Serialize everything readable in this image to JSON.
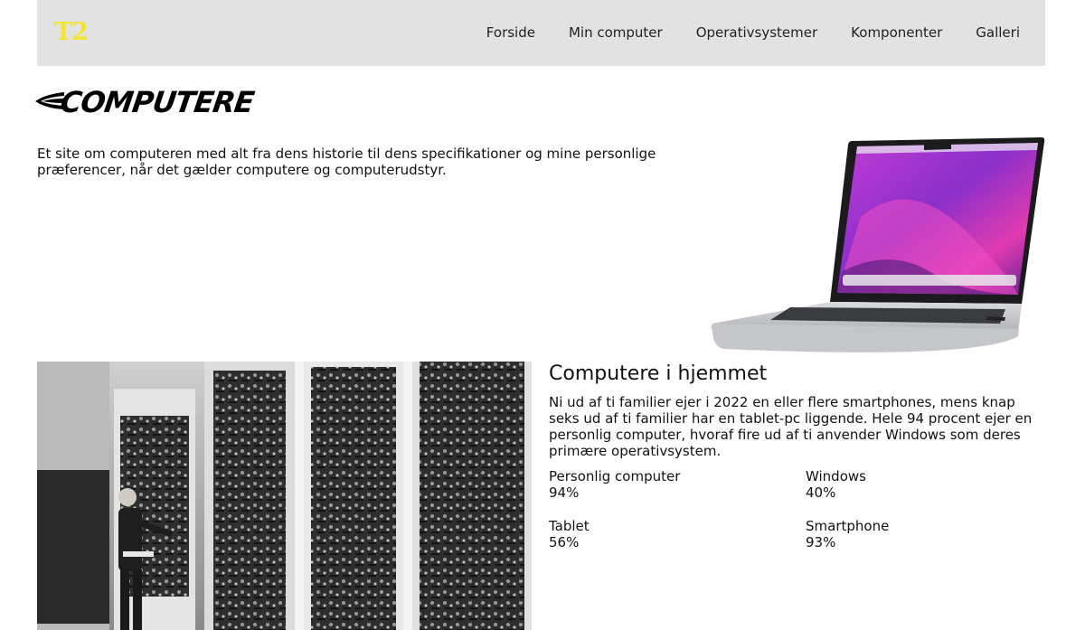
{
  "nav": {
    "logo": "T2",
    "items": [
      {
        "label": "Forside"
      },
      {
        "label": "Min computer"
      },
      {
        "label": "Operativsystemer"
      },
      {
        "label": "Komponenter"
      },
      {
        "label": "Galleri"
      }
    ]
  },
  "brand": {
    "title": "COMPUTERE"
  },
  "intro": {
    "text": "Et site om computeren med alt fra dens historie til dens specifikationer og mine personlige præferencer, når det gælder computere og computerudstyr."
  },
  "article": {
    "heading": "Computere i hjemmet",
    "body": "Ni ud af ti familier ejer i 2022 en eller flere smartphones, mens knap seks ud af ti familier har en tablet-pc liggende. Hele 94 procent ejer en personlig computer, hvoraf fire ud af ti anvender Windows som deres primære operativsystem."
  },
  "stats": [
    {
      "label": "Personlig computer",
      "value": "94%"
    },
    {
      "label": "Windows",
      "value": "40%"
    },
    {
      "label": "Tablet",
      "value": "56%"
    },
    {
      "label": "Smartphone",
      "value": "93%"
    }
  ],
  "colors": {
    "logo": "#f2e62c",
    "nav_bg": "#e2e2e2"
  }
}
